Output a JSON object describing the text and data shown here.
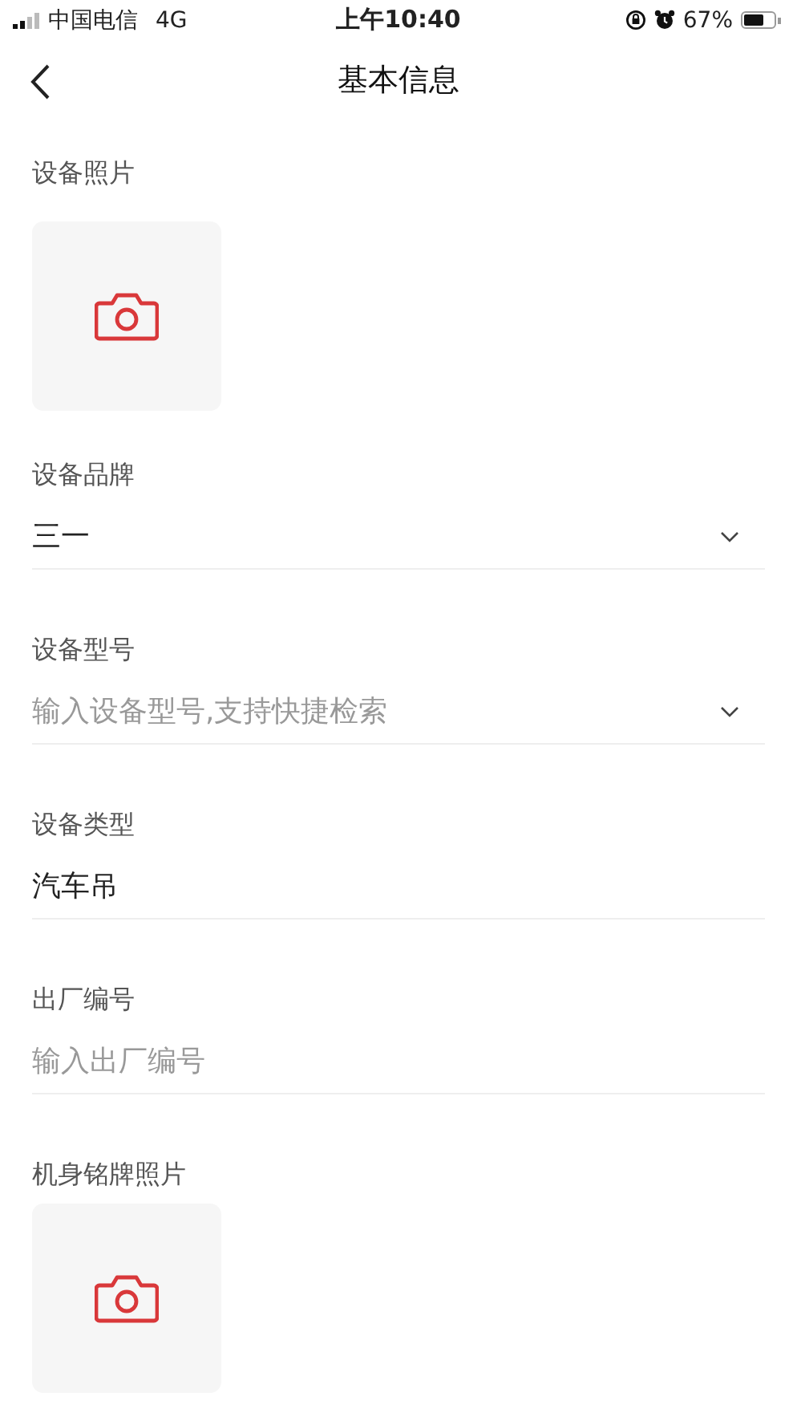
{
  "status_bar": {
    "carrier": "中国电信",
    "network": "4G",
    "time": "上午10:40",
    "battery": "67%"
  },
  "nav": {
    "title": "基本信息"
  },
  "fields": [
    {
      "kind": "photo",
      "label": "设备照片"
    },
    {
      "kind": "select",
      "label": "设备品牌",
      "value": "三一"
    },
    {
      "kind": "select",
      "label": "设备型号",
      "placeholder": "输入设备型号,支持快捷检索"
    },
    {
      "kind": "text",
      "label": "设备类型",
      "value": "汽车吊"
    },
    {
      "kind": "input",
      "label": "出厂编号",
      "placeholder": "输入出厂编号"
    },
    {
      "kind": "photo",
      "label": "机身铭牌照片"
    }
  ]
}
